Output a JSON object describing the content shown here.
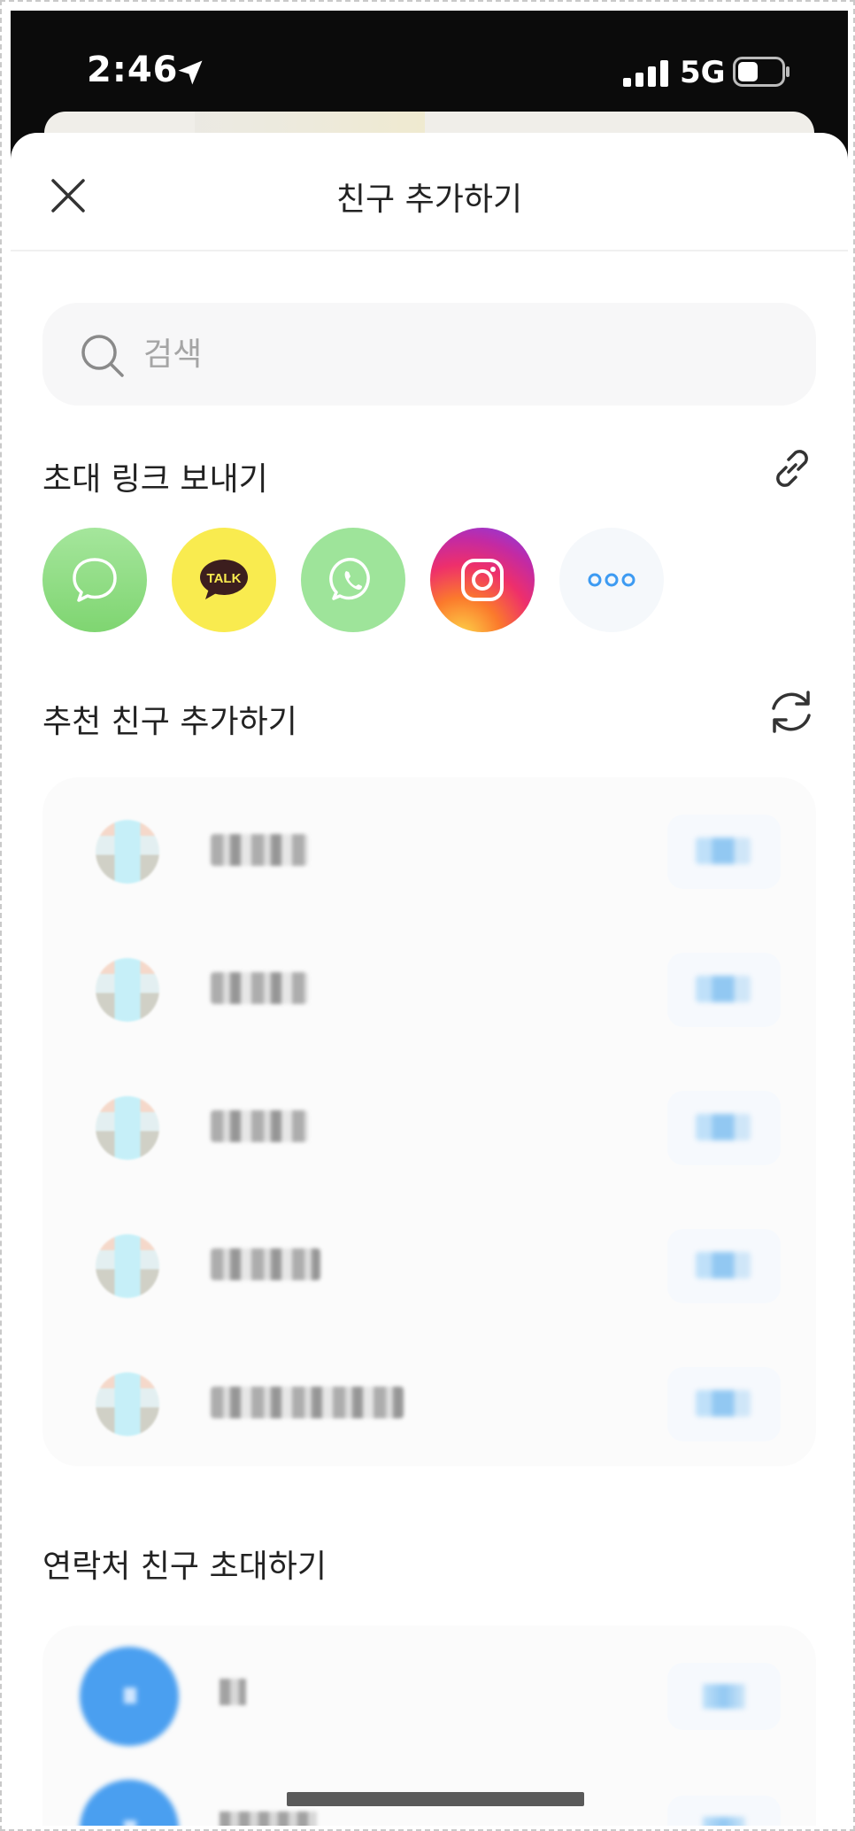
{
  "status_bar": {
    "time": "2:46",
    "network": "5G"
  },
  "header": {
    "title": "친구 추가하기"
  },
  "search": {
    "placeholder": "검색",
    "value": ""
  },
  "invite_link_section": {
    "title": "초대 링크 보내기",
    "share_targets": [
      {
        "name": "messages",
        "icon": "speech-bubble-icon"
      },
      {
        "name": "kakaotalk",
        "icon": "kakaotalk-icon",
        "label": "TALK"
      },
      {
        "name": "whatsapp",
        "icon": "whatsapp-icon"
      },
      {
        "name": "instagram",
        "icon": "instagram-icon"
      },
      {
        "name": "more",
        "icon": "more-dots-icon"
      }
    ]
  },
  "recommended_section": {
    "title": "추천 친구 추가하기"
  },
  "contacts_section": {
    "title": "연락처 친구 초대하기"
  },
  "colors": {
    "accent": "#3d9bf2",
    "text": "#222222",
    "placeholder": "#a5a5a5",
    "card_background": "#fbfbfb"
  }
}
